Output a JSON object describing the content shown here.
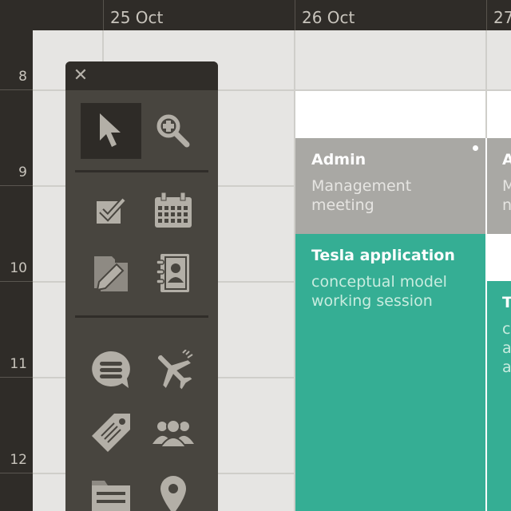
{
  "header": {
    "days": [
      "25 Oct",
      "26 Oct",
      "27"
    ]
  },
  "time_gutter": {
    "hours": [
      "8",
      "9",
      "10",
      "11",
      "12"
    ]
  },
  "events": [
    {
      "title": "Admin",
      "subtitle": "Management meeting",
      "color": "#a9a8a4",
      "subtitle_color": "#e6e5e2"
    },
    {
      "title": "Tesla application",
      "subtitle": "conceptual model working session",
      "color": "#35ae94",
      "subtitle_color": "#c8ecdf"
    },
    {
      "title": "A",
      "subtitle_lines": [
        "M",
        "n"
      ],
      "color": "#a9a8a4"
    },
    {
      "title": "T",
      "subtitle_lines": [
        "c",
        "a",
        "a"
      ],
      "color": "#35ae94"
    }
  ],
  "palette": {
    "close_glyph": "✕",
    "tools": [
      {
        "icon": "arrow-cursor-icon",
        "active": true
      },
      {
        "icon": "zoom-in-icon",
        "active": false
      },
      {
        "icon": "task-checkbox-icon",
        "active": false
      },
      {
        "icon": "calendar-icon",
        "active": false
      },
      {
        "icon": "note-edit-icon",
        "active": false
      },
      {
        "icon": "contacts-book-icon",
        "active": false
      },
      {
        "icon": "chat-bubble-icon",
        "active": false
      },
      {
        "icon": "airplane-icon",
        "active": false
      },
      {
        "icon": "tag-icon",
        "active": false
      },
      {
        "icon": "people-group-icon",
        "active": false
      },
      {
        "icon": "folder-icon",
        "active": false
      },
      {
        "icon": "map-pin-icon",
        "active": false
      }
    ]
  },
  "colors": {
    "chrome_dark": "#2f2c28",
    "grid_background": "#e6e5e3",
    "palette_background": "#48453f",
    "icon": "#b3afa7",
    "admin_event": "#a9a8a4",
    "tesla_event": "#35ae94"
  }
}
